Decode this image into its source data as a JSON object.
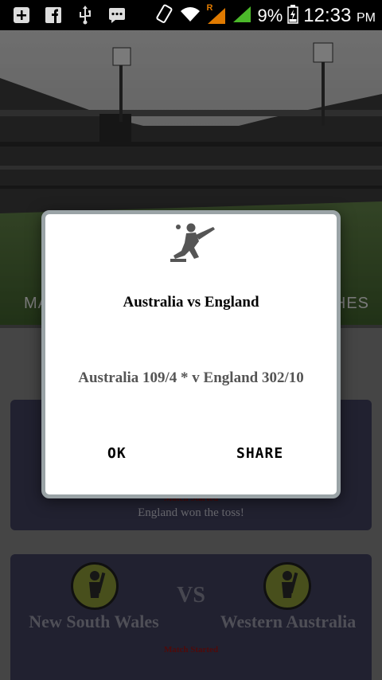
{
  "status_bar": {
    "icons_left": [
      "add-box-icon",
      "facebook-icon",
      "usb-icon",
      "chat-icon"
    ],
    "icons_right": [
      "rotate-icon",
      "wifi-icon",
      "signal-roaming-icon",
      "signal-icon",
      "battery-icon"
    ],
    "roaming_label": "R",
    "battery_percent": "9%",
    "time": "12:33",
    "ampm": "PM"
  },
  "tabs": {
    "left_fragment": "MA",
    "right_fragment": "HES"
  },
  "list": {
    "cards": [
      {
        "status": "Match Started",
        "toss": "England won the toss!"
      },
      {
        "team_left": "New South Wales",
        "vs": "VS",
        "team_right": "Western Australia",
        "status": "Match Started"
      }
    ]
  },
  "dialog": {
    "icon": "cricket-batsman-icon",
    "title": "Australia vs England",
    "score": "Australia 109/4 * v England 302/10",
    "ok_label": "OK",
    "share_label": "SHARE"
  }
}
